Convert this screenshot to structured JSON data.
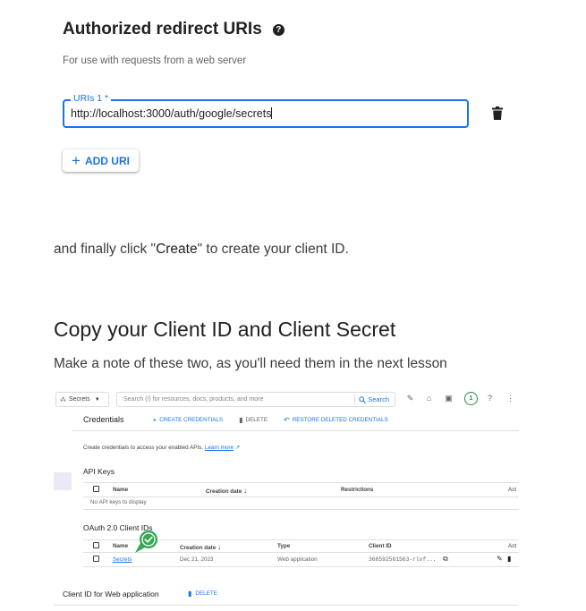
{
  "redirect": {
    "title": "Authorized redirect URIs",
    "help_glyph": "?",
    "subtitle": "For use with requests from a web server",
    "uri_label": "URIs 1 *",
    "uri_value": "http://localhost:3000/auth/google/secrets",
    "add_uri_icon": "+",
    "add_uri_label": "ADD URI"
  },
  "article": {
    "para_before": "and finally click \"",
    "para_emph": "Create",
    "para_after": "\" to create your client ID.",
    "heading": "Copy your Client ID and Client Secret",
    "note": "Make a note of these two, as you'll need them in the next lesson"
  },
  "console": {
    "project": "Secrets",
    "search_placeholder": "Search (/) for resources, docs, products, and more",
    "search_button": "Search",
    "notification_count": "1",
    "page_title": "Credentials",
    "create_credentials": "CREATE CREDENTIALS",
    "delete_label": "DELETE",
    "restore_label": "RESTORE DELETED CREDENTIALS",
    "cred_note": "Create credentials to access your enabled APIs.",
    "learn_more": "Learn more",
    "api_keys": {
      "title": "API Keys",
      "headers": [
        "Name",
        "Creation date",
        "Restrictions",
        "Act"
      ],
      "empty": "No API keys to display"
    },
    "oauth": {
      "title": "OAuth 2.0 Client IDs",
      "headers": [
        "Name",
        "Creation date",
        "Type",
        "Client ID",
        "Act"
      ],
      "row": {
        "name": "Secrets",
        "date": "Dec 21, 2023",
        "type": "Web application",
        "client_id": "368592561563-rlvf..."
      }
    },
    "bottom_title": "Client ID for Web application",
    "bottom_delete": "DELETE"
  },
  "colors": {
    "accent": "#1a73e8",
    "success": "#1e8e3e",
    "success_badge": "#34a853"
  },
  "icons": [
    "help-icon",
    "trash-icon",
    "plus-icon",
    "search-icon",
    "chevron-down-icon",
    "check-icon",
    "copy-icon",
    "edit-icon"
  ]
}
